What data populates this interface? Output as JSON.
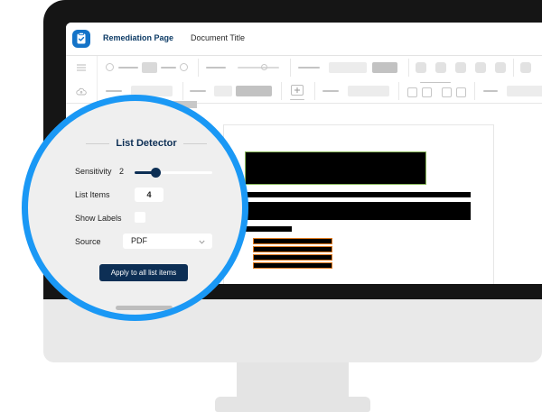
{
  "app": {
    "name": "Remediation Page",
    "document_title": "Document Title",
    "logo_icon": "clipboard-check-icon"
  },
  "colors": {
    "accent": "#1a98f5",
    "brand_navy": "#0d2f55",
    "logo_blue": "#1473c8",
    "list_outline": "#e07a1f"
  },
  "panel": {
    "title": "List Detector",
    "sensitivity": {
      "label": "Sensitivity",
      "value": "2",
      "level": 0.27
    },
    "list_items": {
      "label": "List Items",
      "value": "4"
    },
    "show_labels": {
      "label": "Show Labels",
      "checked": false
    },
    "source": {
      "label": "Source",
      "value": "PDF"
    },
    "apply_label": "Apply to all list items"
  }
}
